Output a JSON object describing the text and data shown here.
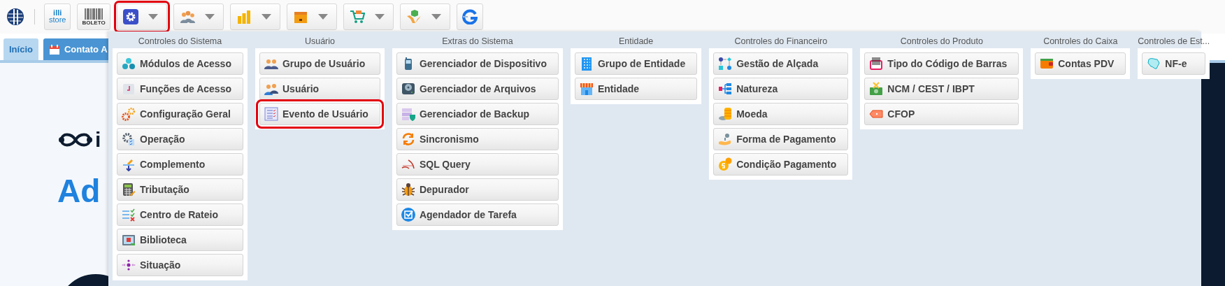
{
  "toolbar": {
    "store_button": {
      "line_1": "illi",
      "line_2": "store"
    },
    "boleto_button": {
      "label": "BOLETO"
    },
    "menus": [
      {
        "selected": true
      },
      {
        "selected": false
      },
      {
        "selected": false
      },
      {
        "selected": false
      },
      {
        "selected": false
      },
      {
        "selected": false
      }
    ]
  },
  "tabs": [
    {
      "label": "Início",
      "selected": true
    },
    {
      "label": "Contato A",
      "selected": false
    }
  ],
  "page": {
    "logo_text": "i",
    "heading": "Ad"
  },
  "menu_panel": {
    "columns": [
      {
        "heading": "Controles do Sistema",
        "items": [
          {
            "label": "Módulos de Acesso",
            "selected": false
          },
          {
            "label": "Funções de Acesso",
            "selected": false
          },
          {
            "label": "Configuração Geral",
            "selected": false
          },
          {
            "label": "Operação",
            "selected": false
          },
          {
            "label": "Complemento",
            "selected": false
          },
          {
            "label": "Tributação",
            "selected": false
          },
          {
            "label": "Centro de Rateio",
            "selected": false
          },
          {
            "label": "Biblioteca",
            "selected": false
          },
          {
            "label": "Situação",
            "selected": false
          }
        ]
      },
      {
        "heading": "Usuário",
        "items": [
          {
            "label": "Grupo de Usuário",
            "selected": false
          },
          {
            "label": "Usuário",
            "selected": false
          },
          {
            "label": "Evento de Usuário",
            "selected": true
          }
        ]
      },
      {
        "heading": "Extras do Sistema",
        "items": [
          {
            "label": "Gerenciador de Dispositivo",
            "selected": false
          },
          {
            "label": "Gerenciador de Arquivos",
            "selected": false
          },
          {
            "label": "Gerenciador de Backup",
            "selected": false
          },
          {
            "label": "Sincronismo",
            "selected": false
          },
          {
            "label": "SQL Query",
            "selected": false
          },
          {
            "label": "Depurador",
            "selected": false
          },
          {
            "label": "Agendador de Tarefa",
            "selected": false
          }
        ]
      },
      {
        "heading": "Entidade",
        "items": [
          {
            "label": "Grupo de Entidade",
            "selected": false
          },
          {
            "label": "Entidade",
            "selected": false
          }
        ]
      },
      {
        "heading": "Controles do Financeiro",
        "items": [
          {
            "label": "Gestão de Alçada",
            "selected": false
          },
          {
            "label": "Natureza",
            "selected": false
          },
          {
            "label": "Moeda",
            "selected": false
          },
          {
            "label": "Forma de Pagamento",
            "selected": false
          },
          {
            "label": "Condição Pagamento",
            "selected": false
          }
        ]
      },
      {
        "heading": "Controles do Produto",
        "items": [
          {
            "label": "Tipo do Código de Barras",
            "selected": false
          },
          {
            "label": "NCM / CEST / IBPT",
            "selected": false
          },
          {
            "label": "CFOP",
            "selected": false
          }
        ]
      },
      {
        "heading": "Controles do Caixa",
        "items": [
          {
            "label": "Contas PDV",
            "selected": false
          }
        ]
      },
      {
        "heading": "Controles de Est...",
        "items": [
          {
            "label": "NF-e",
            "selected": false
          }
        ]
      }
    ]
  }
}
